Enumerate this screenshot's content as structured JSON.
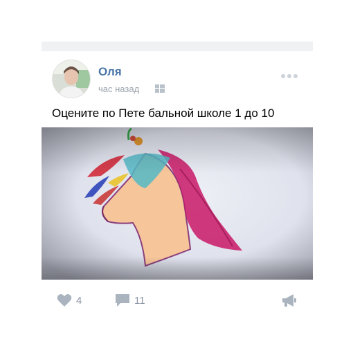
{
  "post": {
    "author": "Оля",
    "time": "час назад",
    "platform_icon": "windows-icon",
    "text": "Оцените по Пете бальной школе 1 до 10",
    "photo_icon": "horse-drawing"
  },
  "actions": {
    "likes": "4",
    "comments": "11",
    "like_icon": "heart-icon",
    "comment_icon": "comment-icon",
    "share_icon": "share-megaphone-icon"
  },
  "colors": {
    "author_link": "#4a76a8",
    "meta_text": "#9aa3ad",
    "action_icon": "#8d98a6",
    "top_bar": "#f0f1f3"
  }
}
